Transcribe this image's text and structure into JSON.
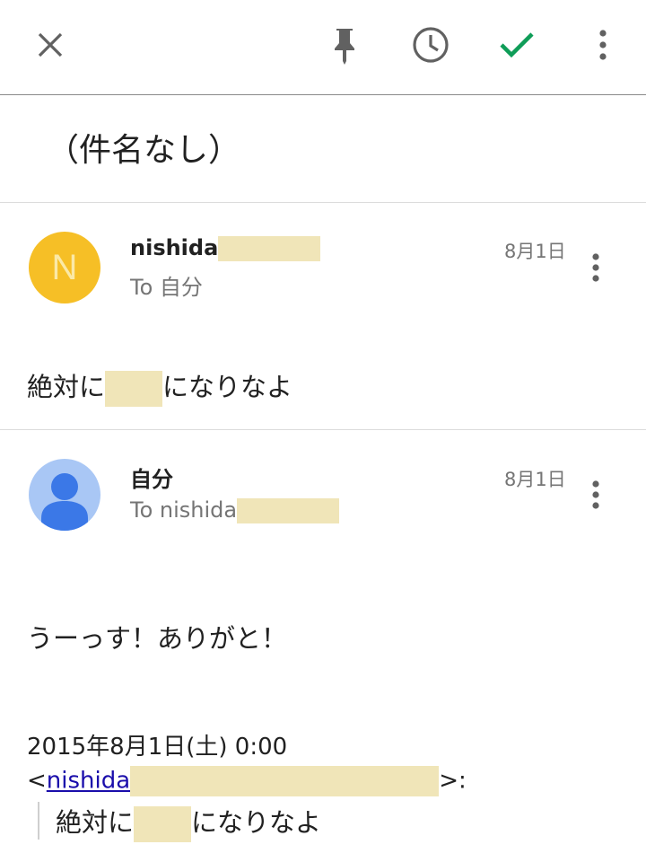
{
  "toolbar": {
    "close_icon": "close-icon",
    "pin_icon": "pin-icon",
    "snooze_icon": "clock-icon",
    "done_icon": "check-icon",
    "more_icon": "more-vert-icon",
    "done_color": "#0f9d58"
  },
  "subject": "（件名なし）",
  "messages": [
    {
      "avatar_letter": "N",
      "avatar_color": "#f6bf26",
      "sender": "nishida",
      "recipient": "To 自分",
      "date": "8月1日",
      "body_before": "絶対に",
      "body_after": "になりなよ"
    },
    {
      "avatar_icon": "person-icon",
      "avatar_color": "#a9c7f5",
      "sender": "自分",
      "recipient": "To nishida",
      "date": "8月1日",
      "body": "うーっす！ありがと！",
      "quote_header_date": "2015年8月1日(土) 0:00",
      "quote_header_open": "<",
      "quote_header_email": "nishida",
      "quote_header_close": ">:",
      "quote_before": "絶対に",
      "quote_after": "になりなよ"
    }
  ],
  "redaction_color": "#f0e5b8"
}
